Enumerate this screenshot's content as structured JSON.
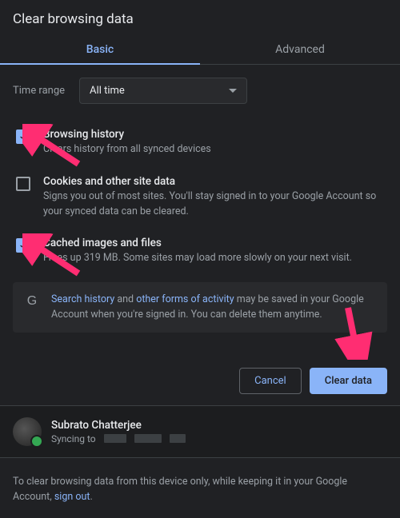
{
  "title": "Clear browsing data",
  "tabs": {
    "basic": "Basic",
    "advanced": "Advanced"
  },
  "time": {
    "label": "Time range",
    "value": "All time"
  },
  "options": [
    {
      "checked": true,
      "title": "Browsing history",
      "desc": "Clears history from all synced devices"
    },
    {
      "checked": false,
      "title": "Cookies and other site data",
      "desc": "Signs you out of most sites. You'll stay signed in to your Google Account so your synced data can be cleared."
    },
    {
      "checked": true,
      "title": "Cached images and files",
      "desc": "Frees up 319 MB. Some sites may load more slowly on your next visit."
    }
  ],
  "info": {
    "link1": "Search history",
    "mid1": " and ",
    "link2": "other forms of activity",
    "rest": " may be saved in your Google Account when you're signed in. You can delete them anytime."
  },
  "buttons": {
    "cancel": "Cancel",
    "clear": "Clear data"
  },
  "account": {
    "name": "Subrato Chatterjee",
    "syncing": "Syncing to"
  },
  "footer": {
    "text": "To clear browsing data from this device only, while keeping it in your Google Account, ",
    "link": "sign out",
    "suffix": "."
  }
}
